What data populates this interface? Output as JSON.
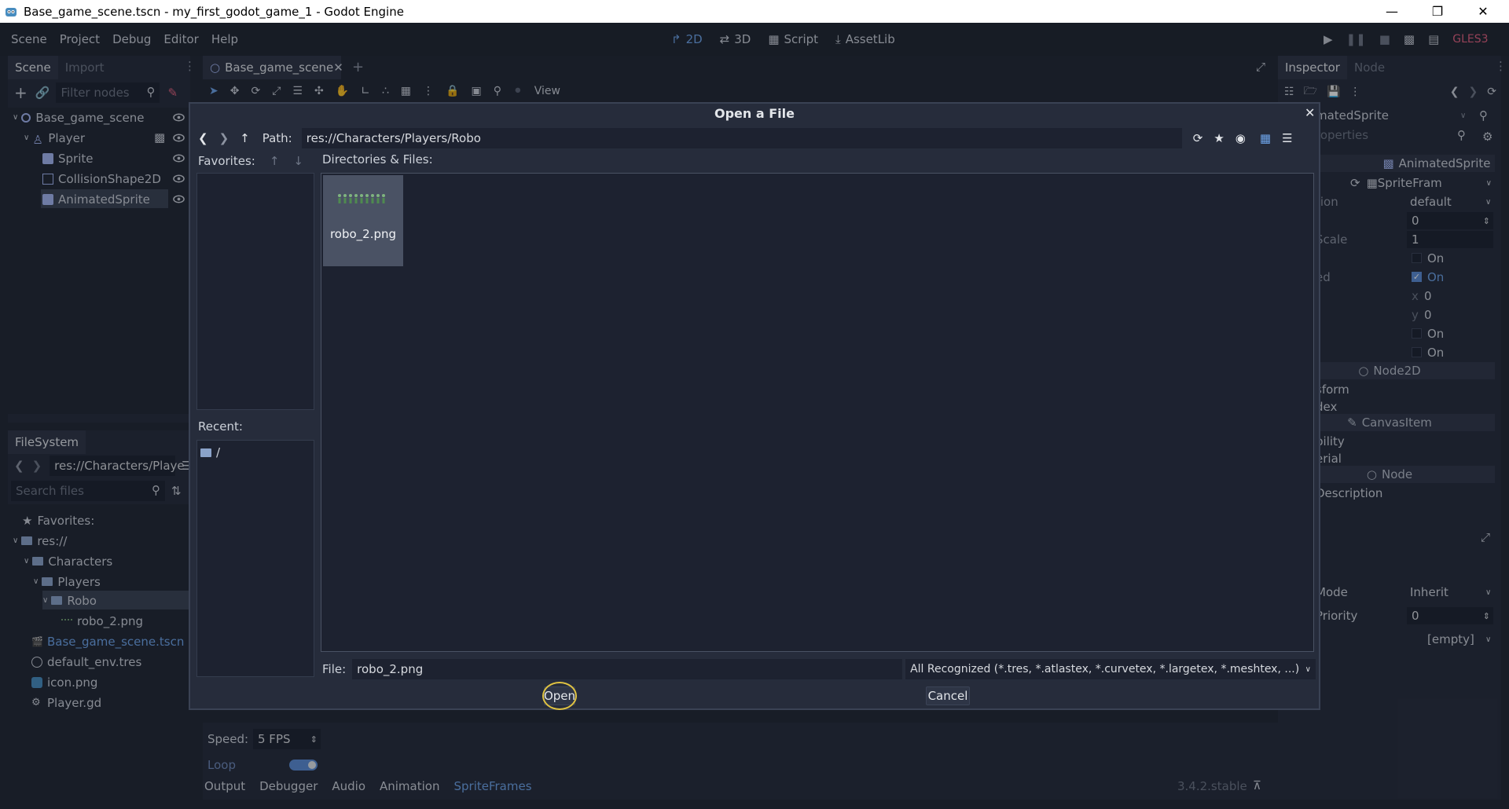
{
  "window": {
    "title": "Base_game_scene.tscn - my_first_godot_game_1 - Godot Engine"
  },
  "menu": {
    "items": [
      "Scene",
      "Project",
      "Debug",
      "Editor",
      "Help"
    ]
  },
  "workspaces": {
    "w2d": "2D",
    "w3d": "3D",
    "script": "Script",
    "assetlib": "AssetLib"
  },
  "renderer": "GLES3",
  "scene_dock": {
    "tab_scene": "Scene",
    "tab_import": "Import",
    "filter_placeholder": "Filter nodes",
    "nodes": [
      "Base_game_scene",
      "Player",
      "Sprite",
      "CollisionShape2D",
      "AnimatedSprite"
    ]
  },
  "scene_tab": {
    "label": "Base_game_scene"
  },
  "toolbar": {
    "view": "View"
  },
  "filesystem": {
    "tab": "FileSystem",
    "path": "res://Characters/Playe",
    "search_placeholder": "Search files",
    "favorites": "Favorites:",
    "items": [
      "res://",
      "Characters",
      "Players",
      "Robo",
      "robo_2.png",
      "Base_game_scene.tscn",
      "default_env.tres",
      "icon.png",
      "Player.gd"
    ]
  },
  "inspector": {
    "tab_inspector": "Inspector",
    "tab_node": "Node",
    "node_name": "matedSprite",
    "filter_placeholder": "roperties",
    "class_header": "AnimatedSprite",
    "frames_value": "SpriteFram",
    "rows": [
      {
        "label": "",
        "value": ""
      },
      {
        "label": "tion",
        "value": "default"
      },
      {
        "label": "",
        "value": "0"
      },
      {
        "label": "Scale",
        "value": "1"
      },
      {
        "label": "",
        "value": "On"
      },
      {
        "label": "ed",
        "value": "On"
      },
      {
        "label": "",
        "value": "0"
      },
      {
        "label": "",
        "value": "0"
      },
      {
        "label": "",
        "value": "On"
      },
      {
        "label": "",
        "value": "On"
      }
    ],
    "axis_x": "x",
    "axis_y": "y",
    "section_node2d": "Node2D",
    "node2d_rows": [
      "sform",
      "dex"
    ],
    "section_canvas": "CanvasItem",
    "canvas_rows": [
      "bility",
      "erial"
    ],
    "section_node": "Node",
    "description": "Description",
    "mode_label": "Mode",
    "mode_value": "Inherit",
    "priority_label": "Priority",
    "priority_value": "0",
    "empty_value": "[empty]"
  },
  "bottom": {
    "speed_label": "Speed:",
    "speed_value": "5 FPS",
    "loop_label": "Loop",
    "tabs": [
      "Output",
      "Debugger",
      "Audio",
      "Animation",
      "SpriteFrames"
    ],
    "version": "3.4.2.stable"
  },
  "dialog": {
    "title": "Open a File",
    "path_label": "Path:",
    "path_value": "res://Characters/Players/Robo",
    "favorites_label": "Favorites:",
    "dirs_label": "Directories & Files:",
    "recent_label": "Recent:",
    "recent_items": [
      "/"
    ],
    "files": [
      {
        "name": "robo_2.png"
      }
    ],
    "file_label": "File:",
    "file_value": "robo_2.png",
    "filter_value": "All Recognized (*.tres, *.atlastex, *.curvetex, *.largetex, *.meshtex, ...)",
    "open_label": "Open",
    "cancel_label": "Cancel"
  },
  "colors": {
    "accent": "#6da3e8",
    "bg": "#212734",
    "panel": "#262c3b",
    "highlight_ring": "#e0c341"
  }
}
